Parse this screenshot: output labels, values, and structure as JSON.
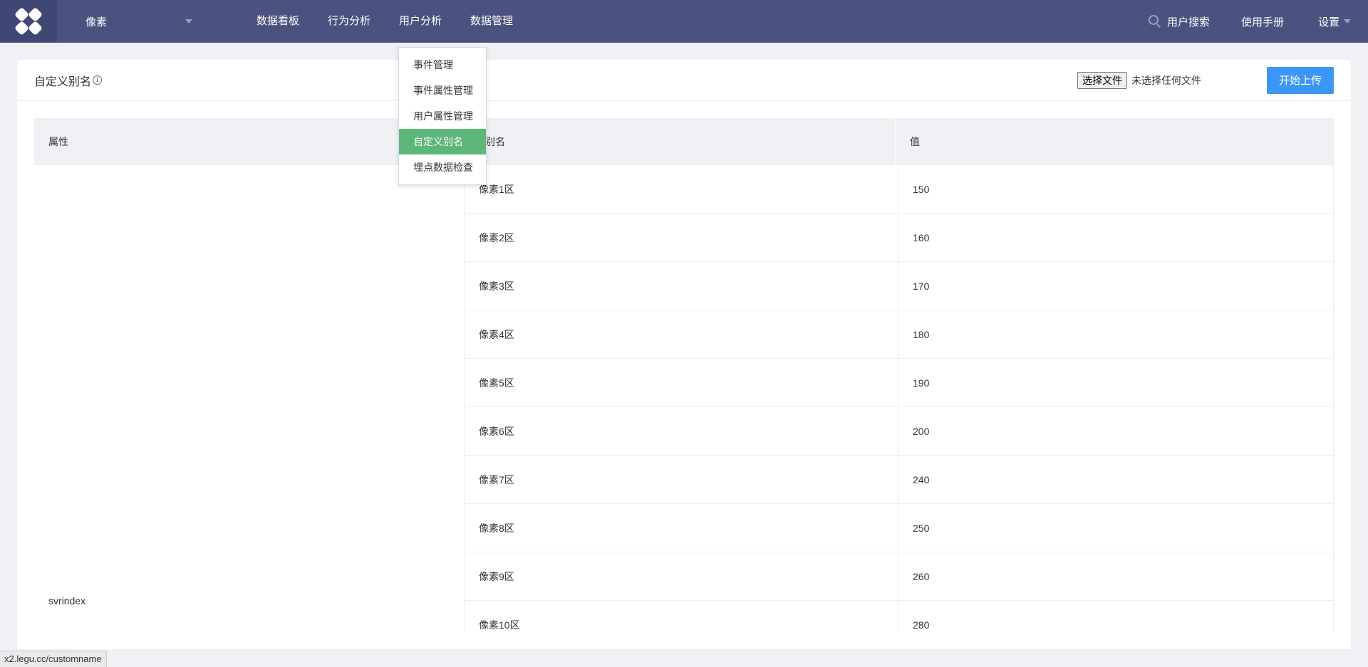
{
  "header": {
    "logo_icon": "four-diamond-logo-icon",
    "project": "像素",
    "nav": [
      "数据看板",
      "行为分析",
      "用户分析",
      "数据管理"
    ],
    "search_label": "用户搜索",
    "manual_label": "使用手册",
    "settings_label": "设置"
  },
  "dropdown": {
    "items": [
      "事件管理",
      "事件属性管理",
      "用户属性管理",
      "自定义别名",
      "埋点数据检查"
    ],
    "active": "自定义别名",
    "active_color": "#5db67a"
  },
  "panel": {
    "title": "自定义别名",
    "info_glyph": "i",
    "file_button": "选择文件",
    "file_status": "未选择任何文件",
    "upload_button": "开始上传"
  },
  "table": {
    "headers": [
      "属性",
      "别名",
      "值"
    ],
    "property": "svrindex",
    "rows": [
      {
        "alias": "像素1区",
        "value": "150"
      },
      {
        "alias": "像素2区",
        "value": "160"
      },
      {
        "alias": "像素3区",
        "value": "170"
      },
      {
        "alias": "像素4区",
        "value": "180"
      },
      {
        "alias": "像素5区",
        "value": "190"
      },
      {
        "alias": "像素6区",
        "value": "200"
      },
      {
        "alias": "像素7区",
        "value": "240"
      },
      {
        "alias": "像素8区",
        "value": "250"
      },
      {
        "alias": "像素9区",
        "value": "260"
      },
      {
        "alias": "像素10区",
        "value": "280"
      }
    ]
  },
  "statusbar": {
    "url": "x2.legu.cc/customname"
  },
  "colors": {
    "topbar": "#4a5380",
    "upload_button": "#3b97f6"
  }
}
